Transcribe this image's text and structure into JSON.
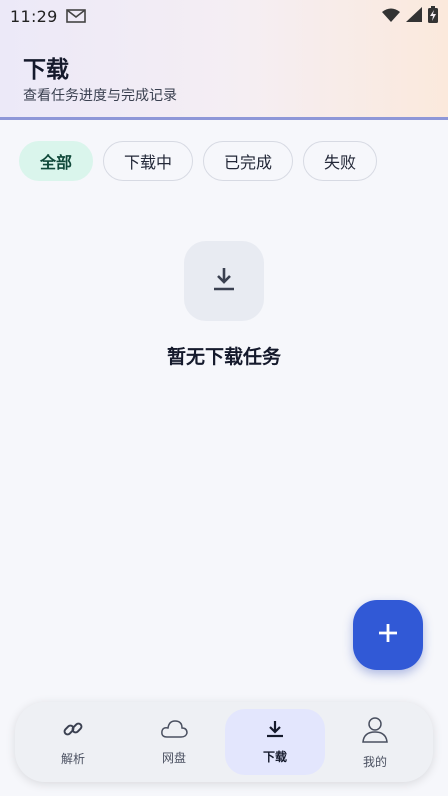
{
  "status_bar": {
    "time": "11:29",
    "icons": [
      "mail-icon",
      "wifi-icon",
      "signal-icon",
      "battery-charging-icon"
    ]
  },
  "header": {
    "title": "下载",
    "subtitle": "查看任务进度与完成记录"
  },
  "filters": [
    {
      "label": "全部",
      "active": true
    },
    {
      "label": "下载中",
      "active": false
    },
    {
      "label": "已完成",
      "active": false
    },
    {
      "label": "失败",
      "active": false
    }
  ],
  "empty_state": {
    "icon": "download-icon",
    "text": "暂无下载任务"
  },
  "fab": {
    "icon": "plus-icon"
  },
  "bottom_nav": [
    {
      "label": "解析",
      "icon": "link-icon",
      "active": false
    },
    {
      "label": "网盘",
      "icon": "cloud-icon",
      "active": false
    },
    {
      "label": "下载",
      "icon": "download-icon",
      "active": true
    },
    {
      "label": "我的",
      "icon": "user-icon",
      "active": false
    }
  ],
  "colors": {
    "accent": "#3159d6",
    "active_chip_bg": "#daf5ec",
    "active_nav_bg": "#e3e6fd",
    "header_border": "#8e97d8"
  }
}
